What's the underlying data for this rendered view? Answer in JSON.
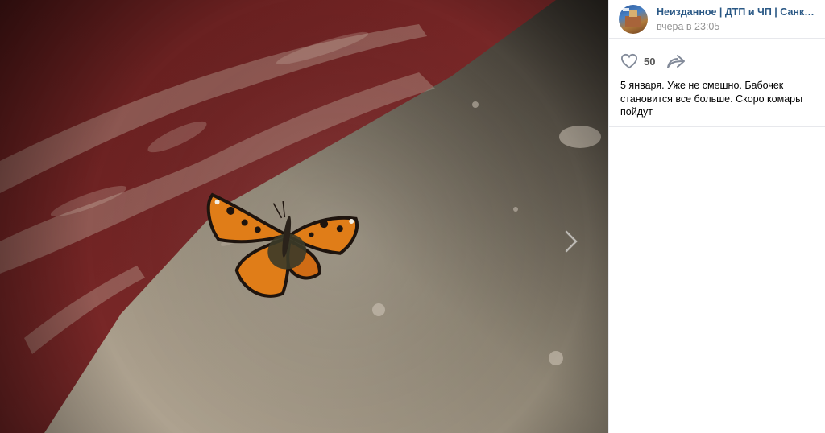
{
  "post": {
    "author": "Неизданное | ДТП и ЧП | Санкт-Петербург",
    "date": "вчера в 23:05",
    "text": "5 января. Уже не смешно. Бабочек становится все больше. Скоро комары пойдут",
    "likes": "50"
  },
  "icons": {
    "like": "heart-outline-icon",
    "share": "share-arrow-icon",
    "next": "chevron-right-icon"
  },
  "colors": {
    "link": "#2a5885",
    "date": "#939393",
    "icon": "#828a99"
  }
}
